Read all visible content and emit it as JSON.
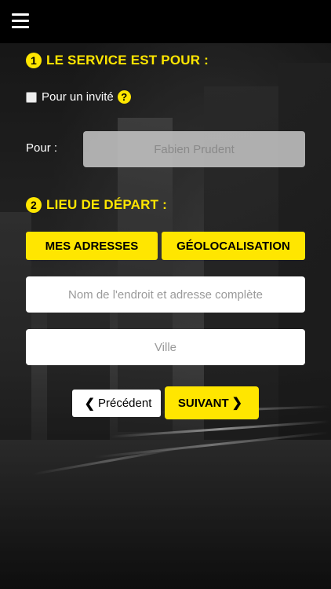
{
  "menu": {
    "icon": "hamburger-menu-icon"
  },
  "section1": {
    "number": "1",
    "title": "LE SERVICE EST POUR :"
  },
  "guest": {
    "label": "Pour un invité",
    "checked": false,
    "help_icon": "?"
  },
  "pour": {
    "label": "Pour :",
    "value": "Fabien Prudent"
  },
  "section2": {
    "number": "2",
    "title": "LIEU DE DÉPART :"
  },
  "buttons": {
    "mes_adresses": "MES ADRESSES",
    "geolocalisation": "GÉOLOCALISATION",
    "previous": "Précédent",
    "next": "SUIVANT"
  },
  "fields": {
    "address_placeholder": "Nom de l'endroit et adresse complète",
    "city_placeholder": "Ville"
  },
  "colors": {
    "accent": "#ffe600",
    "topbar": "#000000"
  }
}
